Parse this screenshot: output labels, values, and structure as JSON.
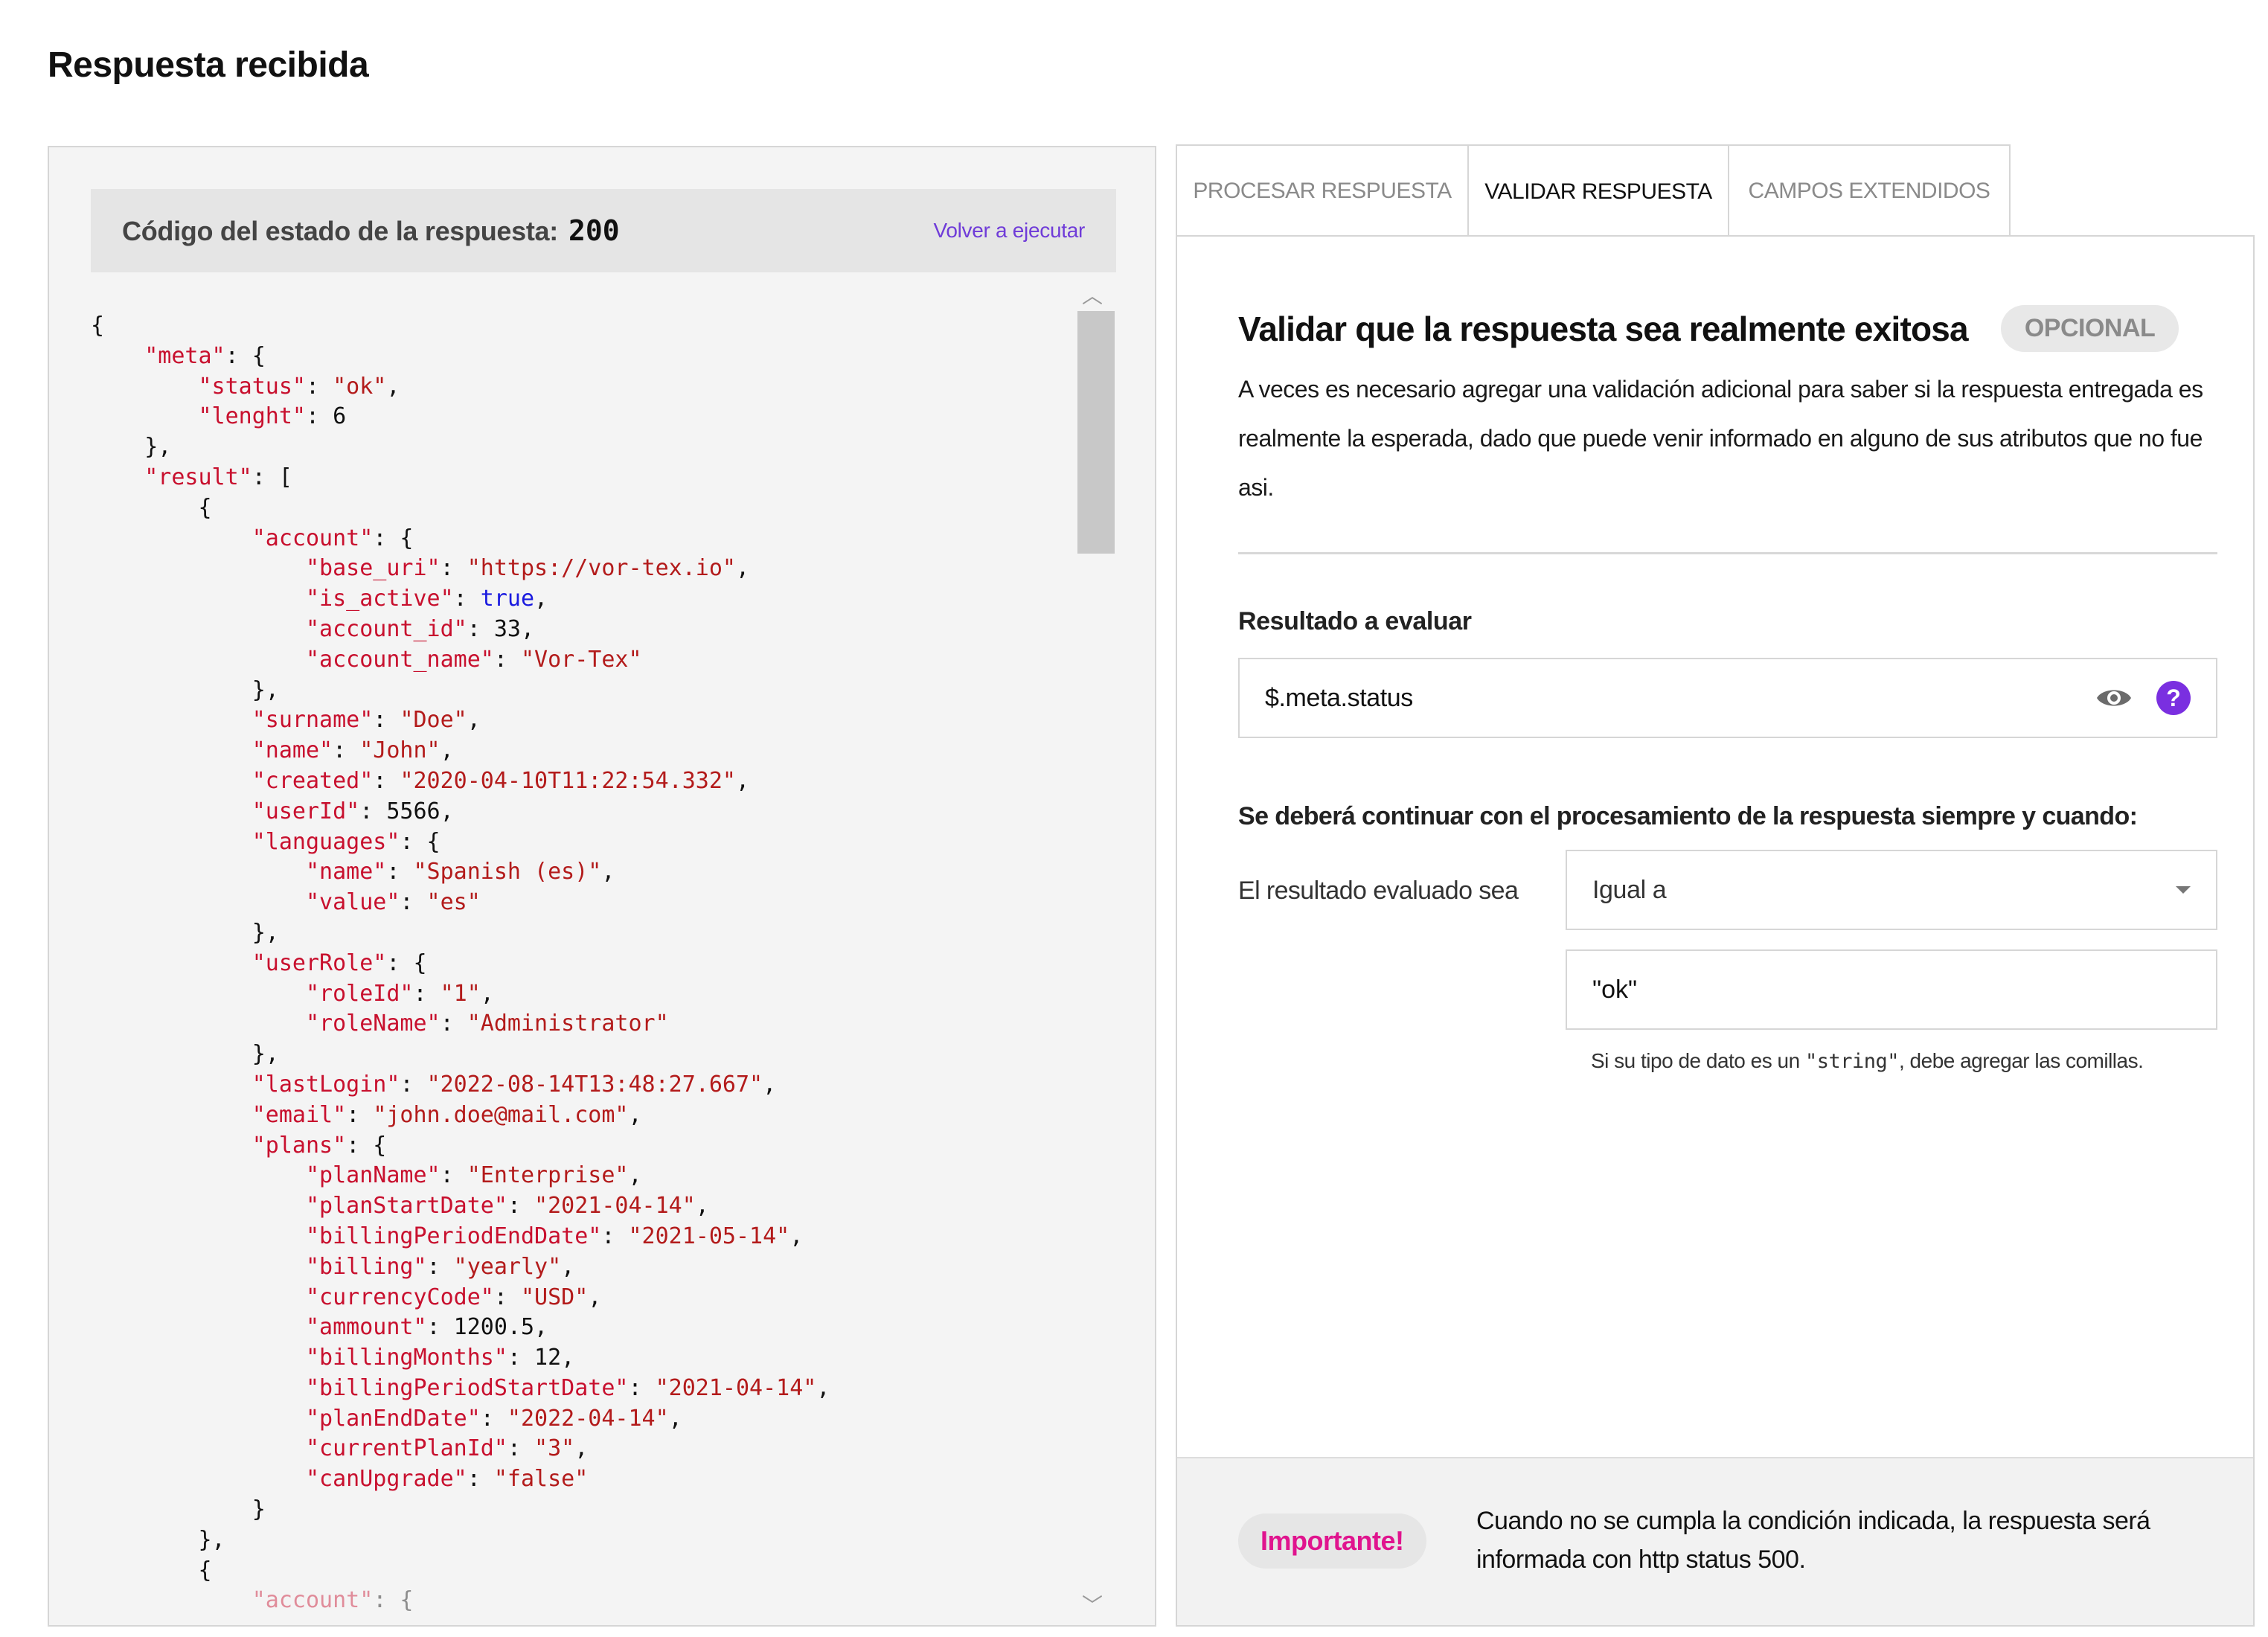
{
  "page": {
    "title": "Respuesta recibida"
  },
  "response": {
    "status_label": "Código del estado de la respuesta:",
    "status_code": "200",
    "rerun_label": "Volver a ejecutar"
  },
  "tabs": [
    {
      "label": "PROCESAR RESPUESTA",
      "active": false
    },
    {
      "label": "VALIDAR RESPUESTA",
      "active": true
    },
    {
      "label": "CAMPOS EXTENDIDOS",
      "active": false
    }
  ],
  "validation": {
    "title": "Validar que la respuesta sea realmente exitosa",
    "optional_badge": "OPCIONAL",
    "description": "A veces es necesario agregar una validación adicional para saber si la respuesta entregada es realmente la esperada, dado que puede venir informado en alguno de sus atributos que no fue asi.",
    "result_label": "Resultado a evaluar",
    "result_value": "$.meta.status",
    "condition_title": "Se deberá continuar con el procesamiento de la respuesta siempre y cuando:",
    "condition_label": "El resultado evaluado sea",
    "operator_selected": "Igual a",
    "compare_value": "\"ok\"",
    "hint_prefix": "Si su tipo de dato es un ",
    "hint_code": "\"string\"",
    "hint_suffix": ", debe agregar las comillas."
  },
  "notice": {
    "badge": "Importante!",
    "text": "Cuando no se cumpla la condición indicada, la respuesta será informada con http status 500."
  },
  "colors": {
    "accent_purple": "#7a2fe0",
    "link_purple": "#6f3bd8",
    "important_pink": "#e0148e",
    "json_key_red": "#c8102e",
    "json_bool_blue": "#1a1adf"
  },
  "icons": [
    "eye-icon",
    "help-icon",
    "chevron-down-icon",
    "scroll-up-icon",
    "scroll-down-icon"
  ],
  "json_lines": [
    "{",
    "    \"meta\": {",
    "        \"status\": \"ok\",",
    "        \"lenght\": 6",
    "    },",
    "    \"result\": [",
    "        {",
    "            \"account\": {",
    "                \"base_uri\": \"https://vor-tex.io\",",
    "                \"is_active\": true,",
    "                \"account_id\": 33,",
    "                \"account_name\": \"Vor-Tex\"",
    "            },",
    "            \"surname\": \"Doe\",",
    "            \"name\": \"John\",",
    "            \"created\": \"2020-04-10T11:22:54.332\",",
    "            \"userId\": 5566,",
    "            \"languages\": {",
    "                \"name\": \"Spanish (es)\",",
    "                \"value\": \"es\"",
    "            },",
    "            \"userRole\": {",
    "                \"roleId\": \"1\",",
    "                \"roleName\": \"Administrator\"",
    "            },",
    "            \"lastLogin\": \"2022-08-14T13:48:27.667\",",
    "            \"email\": \"john.doe@mail.com\",",
    "            \"plans\": {",
    "                \"planName\": \"Enterprise\",",
    "                \"planStartDate\": \"2021-04-14\",",
    "                \"billingPeriodEndDate\": \"2021-05-14\",",
    "                \"billing\": \"yearly\",",
    "                \"currencyCode\": \"USD\",",
    "                \"ammount\": 1200.5,",
    "                \"billingMonths\": 12,",
    "                \"billingPeriodStartDate\": \"2021-04-14\",",
    "                \"planEndDate\": \"2022-04-14\",",
    "                \"currentPlanId\": \"3\",",
    "                \"canUpgrade\": \"false\"",
    "            }",
    "        },",
    "        {",
    "            \"account\": {"
  ]
}
